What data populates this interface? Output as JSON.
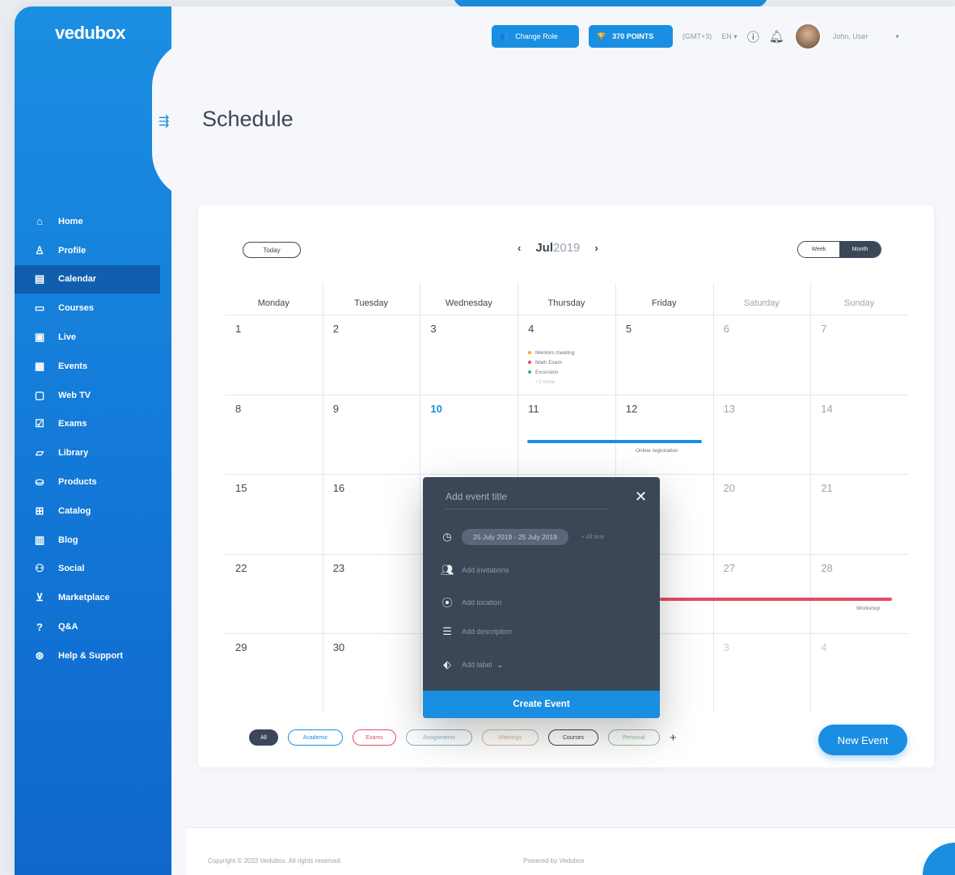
{
  "app": {
    "logo": "vedubox"
  },
  "header": {
    "change_role": "Change Role",
    "points": "370 POINTS",
    "timezone": "(GMT+3)",
    "language": "EN",
    "user_name": "John, User"
  },
  "page": {
    "title": "Schedule"
  },
  "sidebar": {
    "items": [
      {
        "label": "Home",
        "icon": "home-icon"
      },
      {
        "label": "Profile",
        "icon": "user-icon"
      },
      {
        "label": "Calendar",
        "icon": "calendar-icon"
      },
      {
        "label": "Courses",
        "icon": "courses-icon"
      },
      {
        "label": "Live",
        "icon": "live-icon"
      },
      {
        "label": "Events",
        "icon": "events-icon"
      },
      {
        "label": "Web TV",
        "icon": "tv-icon"
      },
      {
        "label": "Exams",
        "icon": "exams-icon"
      },
      {
        "label": "Library",
        "icon": "folder-icon"
      },
      {
        "label": "Products",
        "icon": "basket-icon"
      },
      {
        "label": "Catalog",
        "icon": "catalog-icon"
      },
      {
        "label": "Blog",
        "icon": "blog-icon"
      },
      {
        "label": "Social",
        "icon": "social-icon"
      },
      {
        "label": "Marketplace",
        "icon": "cart-icon"
      },
      {
        "label": "Q&A",
        "icon": "question-icon"
      },
      {
        "label": "Help & Support",
        "icon": "lifebuoy-icon"
      }
    ],
    "active": "Calendar"
  },
  "calendar": {
    "today_label": "Today",
    "month": "Jul",
    "year": "2019",
    "view_week": "Week",
    "view_month": "Month",
    "weekdays": [
      "Monday",
      "Tuesday",
      "Wednesday",
      "Thursday",
      "Friday",
      "Saturday",
      "Sunday"
    ],
    "weeks": [
      [
        "1",
        "2",
        "3",
        "4",
        "5",
        "6",
        "7"
      ],
      [
        "8",
        "9",
        "10",
        "11",
        "12",
        "13",
        "14"
      ],
      [
        "15",
        "16",
        "",
        "",
        "",
        "20",
        "21"
      ],
      [
        "22",
        "23",
        "",
        "",
        "",
        "27",
        "28"
      ],
      [
        "29",
        "30",
        "",
        "",
        "",
        "3",
        "4"
      ]
    ],
    "today_day": "10",
    "events_day4": [
      {
        "label": "Mentors meeting",
        "color": "#f5a623"
      },
      {
        "label": "Math Exam",
        "color": "#e84a5f"
      },
      {
        "label": "Excursion",
        "color": "#2bb673"
      }
    ],
    "events_day4_more": "+2 more",
    "range_event_blue": "Online registration",
    "range_event_red": "Workshop"
  },
  "filters": [
    {
      "label": "All",
      "color": "#3b4656"
    },
    {
      "label": "Academic",
      "color": "#1a8ee0"
    },
    {
      "label": "Exams",
      "color": "#e84a5f"
    },
    {
      "label": "Assignments",
      "color": "#7fb4d6"
    },
    {
      "label": "Meetings",
      "color": "#d8b58a"
    },
    {
      "label": "Courses",
      "color": "#3b4656"
    },
    {
      "label": "Personal",
      "color": "#8fc19a"
    }
  ],
  "new_event_label": "New Event",
  "modal": {
    "title_placeholder": "Add event title",
    "date_range": "25 July 2019 - 25 July 2019",
    "all_day": "+ All time",
    "invitations": "Add invitations",
    "location": "Add location",
    "description": "Add description",
    "label": "Add label",
    "create": "Create Event"
  },
  "footer": {
    "copyright": "Copyright © 2022 Vedubox. All rights reserved.",
    "powered": "Powered by Vedubox",
    "lang": "en"
  }
}
